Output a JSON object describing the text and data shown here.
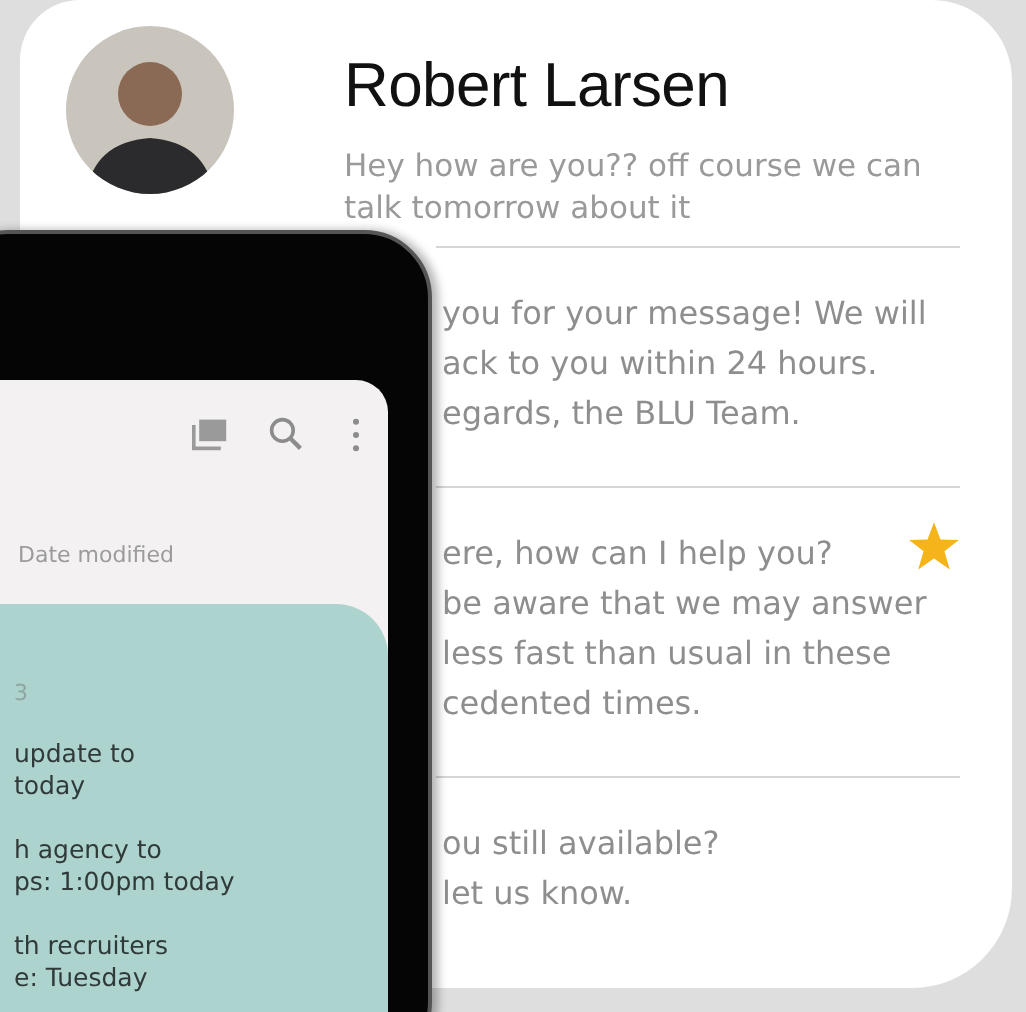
{
  "contact": {
    "name": "Robert Larsen",
    "preview": "Hey how are you?? off course we can talk tomorrow about it"
  },
  "messages": [
    {
      "lines": [
        "you for your message! We will",
        "ack to you within 24 hours.",
        "egards, the BLU Team."
      ],
      "starred": false
    },
    {
      "lines": [
        "ere, how can I help you?",
        "be aware that we may answer",
        "less fast than usual in these",
        "cedented times."
      ],
      "starred": true
    },
    {
      "lines": [
        "ou still available?",
        "let us know."
      ],
      "starred": false
    }
  ],
  "phone": {
    "sort_label": "Date modified",
    "note": {
      "date": "3",
      "items": [
        {
          "lines": [
            "update to",
            "today"
          ]
        },
        {
          "lines": [
            "h agency to",
            "ps: 1:00pm today"
          ]
        },
        {
          "lines": [
            "th recruiters",
            "e: Tuesday"
          ]
        }
      ]
    }
  }
}
